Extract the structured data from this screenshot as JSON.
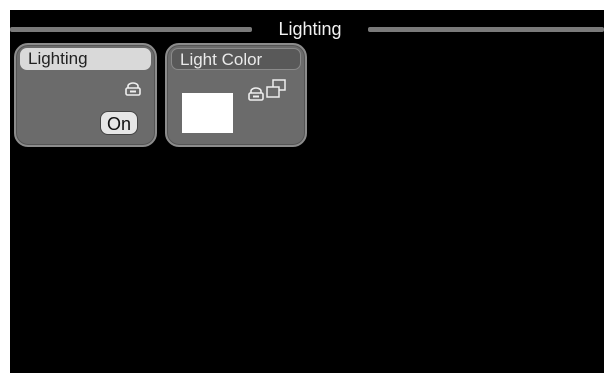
{
  "header": {
    "title": "Lighting"
  },
  "cards": {
    "lighting": {
      "label": "Lighting",
      "toggle_value": "On",
      "icon": "lock-icon"
    },
    "light_color": {
      "label": "Light Color",
      "swatch_color": "#ffffff",
      "icons": [
        "lock-icon",
        "copy-icon"
      ]
    }
  },
  "colors": {
    "background": "#000000",
    "card": "#6b6b6b",
    "header_active": "#d9d9d9"
  }
}
